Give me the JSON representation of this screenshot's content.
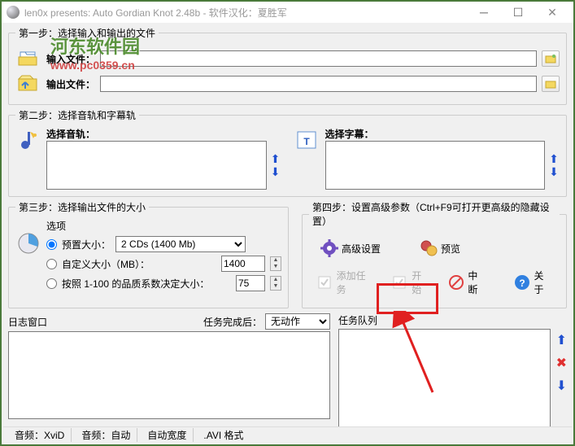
{
  "window": {
    "title": "len0x presents: Auto Gordian Knot 2.48b - 软件汉化：夏胜军"
  },
  "watermark": {
    "logo": "河东软件园",
    "url": "www.pc0359.cn"
  },
  "step1": {
    "legend": "第一步：选择输入和输出的文件",
    "input_label": "输入文件：",
    "output_label": "输出文件："
  },
  "step2": {
    "legend": "第二步：选择音轨和字幕轨",
    "audio_label": "选择音轨：",
    "subtitle_label": "选择字幕："
  },
  "step3": {
    "legend": "第三步：选择输出文件的大小",
    "options_label": "选项",
    "preset_label": "预置大小：",
    "preset_value": "2 CDs  (1400 Mb)",
    "custom_label": "自定义大小（MB）：",
    "custom_value": "1400",
    "quality_label": "按照 1-100 的品质系数决定大小：",
    "quality_value": "75"
  },
  "step4": {
    "legend": "第四步：设置高级参数（Ctrl+F9可打开更高级的隐藏设置）",
    "advanced": "高级设置",
    "preview": "预览",
    "add_task": "添加任务",
    "start": "开始",
    "abort": "中断",
    "about": "关于"
  },
  "log": {
    "title": "日志窗口",
    "after_label": "任务完成后：",
    "after_value": "无动作"
  },
  "queue": {
    "title": "任务队列"
  },
  "status": {
    "video": "音频：XviD",
    "audio": "音频：自动",
    "width": "自动宽度",
    "format": ".AVI 格式"
  }
}
